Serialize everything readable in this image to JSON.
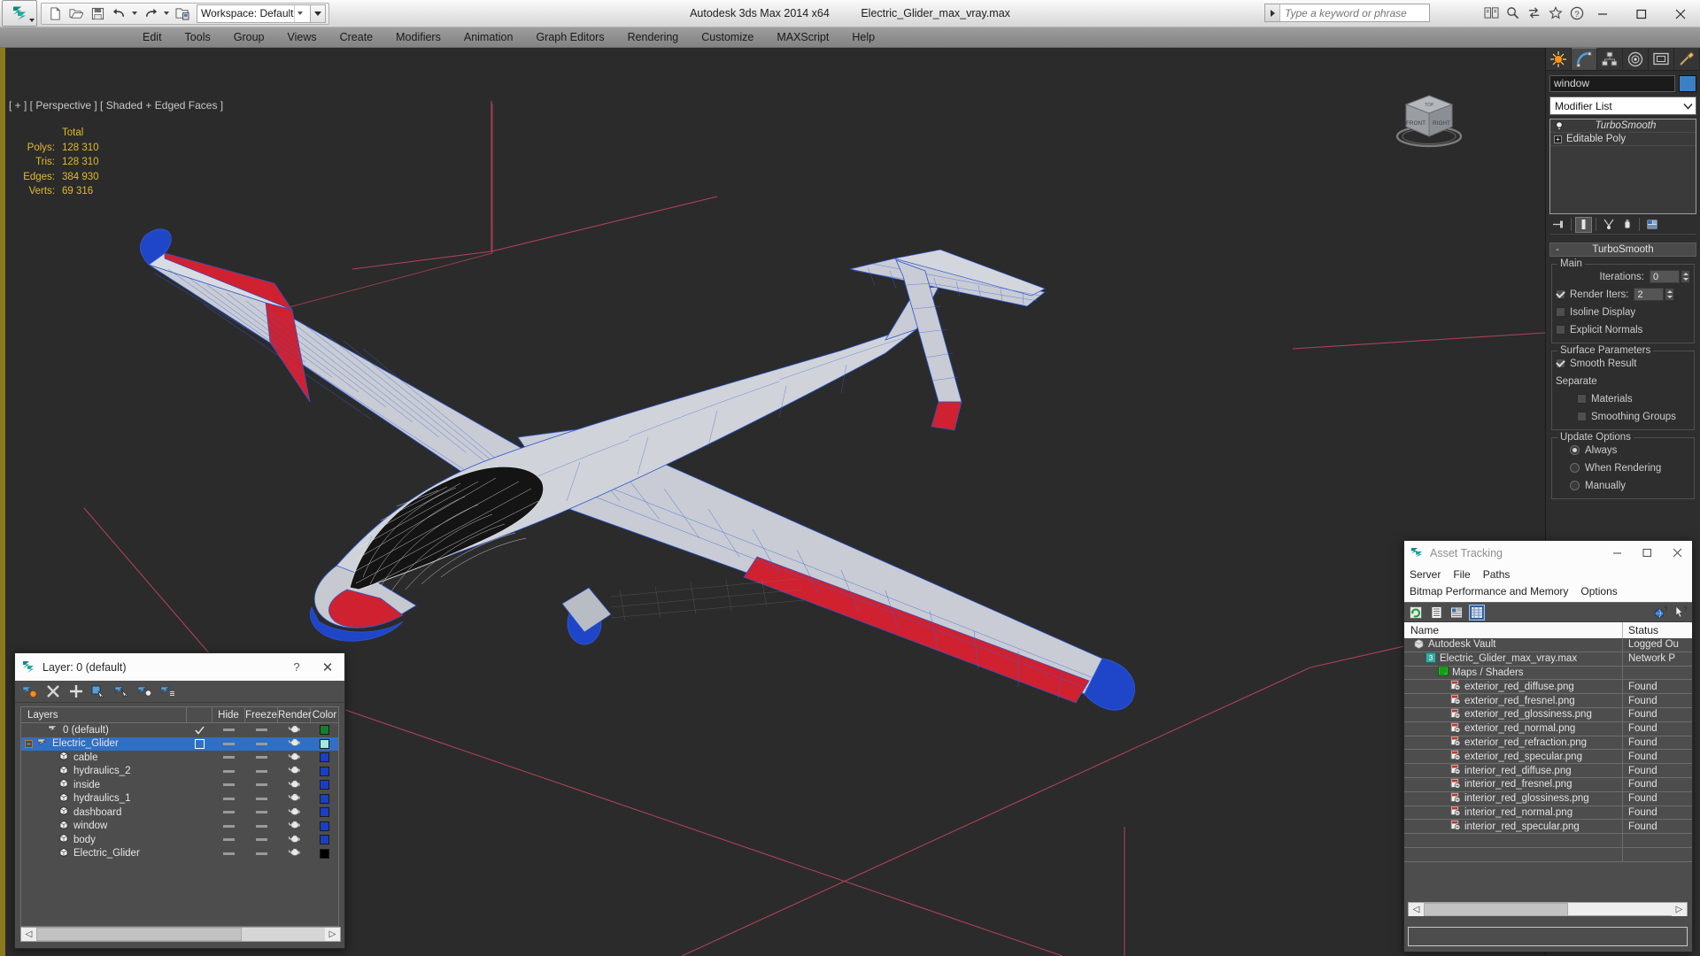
{
  "app": {
    "title": "Autodesk 3ds Max  2014 x64",
    "file": "Electric_Glider_max_vray.max",
    "workspace_label": "Workspace: Default",
    "search_placeholder": "Type a keyword or phrase"
  },
  "menu": {
    "items": [
      "Edit",
      "Tools",
      "Group",
      "Views",
      "Create",
      "Modifiers",
      "Animation",
      "Graph Editors",
      "Rendering",
      "Customize",
      "MAXScript",
      "Help"
    ]
  },
  "viewport": {
    "label": "[ + ] [ Perspective ] [ Shaded + Edged Faces ]",
    "stats_header": "Total",
    "stats": [
      {
        "label": "Polys:",
        "value": "128 310"
      },
      {
        "label": "Tris:",
        "value": "128 310"
      },
      {
        "label": "Edges:",
        "value": "384 930"
      },
      {
        "label": "Verts:",
        "value": "69 316"
      }
    ],
    "viewcube_faces": [
      "FRONT",
      "RIGHT",
      "TOP"
    ],
    "accent_color": "#8a7a1e"
  },
  "command_panel": {
    "tabs": [
      "create-tab",
      "modify-tab",
      "hierarchy-tab",
      "motion-tab",
      "display-tab",
      "utilities-tab"
    ],
    "active_tab": "modify-tab",
    "object_name": "window",
    "object_color": "#3d7fc4",
    "modifier_list_label": "Modifier List",
    "stack": [
      {
        "name": "TurboSmooth",
        "italic": true
      },
      {
        "name": "Editable Poly",
        "italic": false
      }
    ],
    "rollout": {
      "title": "TurboSmooth",
      "groups": [
        {
          "title": "Main",
          "iterations_label": "Iterations:",
          "iterations_value": "0",
          "render_iters_label": "Render Iters:",
          "render_iters_value": "2",
          "render_iters_checked": true,
          "isoline_label": "Isoline Display",
          "isoline_checked": false,
          "explicit_label": "Explicit Normals",
          "explicit_checked": false
        },
        {
          "title": "Surface Parameters",
          "smooth_label": "Smooth Result",
          "smooth_checked": true,
          "separate_label": "Separate",
          "materials_label": "Materials",
          "materials_checked": false,
          "smoothing_groups_label": "Smoothing Groups",
          "smoothing_groups_checked": false
        },
        {
          "title": "Update Options",
          "options": [
            "Always",
            "When Rendering",
            "Manually"
          ],
          "selected": "Always"
        }
      ]
    }
  },
  "layer_dialog": {
    "title": "Layer: 0 (default)",
    "help_label": "?",
    "close_label": "✕",
    "columns": [
      "Layers",
      "Hide",
      "Freeze",
      "Render",
      "Color"
    ],
    "rows": [
      {
        "name": "0 (default)",
        "indent": 1,
        "icon": "layer-icon",
        "current": true,
        "color": "#128028",
        "selected": false,
        "expander": false
      },
      {
        "name": "Electric_Glider",
        "indent": 0,
        "icon": "layer-icon",
        "current": false,
        "color": "#9eecd6",
        "selected": true,
        "expander": true
      },
      {
        "name": "cable",
        "indent": 2,
        "icon": "object-icon",
        "current": false,
        "color": "#1a3fc4",
        "selected": false,
        "expander": false
      },
      {
        "name": "hydraulics_2",
        "indent": 2,
        "icon": "object-icon",
        "current": false,
        "color": "#1a3fc4",
        "selected": false,
        "expander": false
      },
      {
        "name": "inside",
        "indent": 2,
        "icon": "object-icon",
        "current": false,
        "color": "#1a3fc4",
        "selected": false,
        "expander": false
      },
      {
        "name": "hydraulics_1",
        "indent": 2,
        "icon": "object-icon",
        "current": false,
        "color": "#1a3fc4",
        "selected": false,
        "expander": false
      },
      {
        "name": "dashboard",
        "indent": 2,
        "icon": "object-icon",
        "current": false,
        "color": "#1a3fc4",
        "selected": false,
        "expander": false
      },
      {
        "name": "window",
        "indent": 2,
        "icon": "object-icon",
        "current": false,
        "color": "#1a3fc4",
        "selected": false,
        "expander": false
      },
      {
        "name": "body",
        "indent": 2,
        "icon": "object-icon",
        "current": false,
        "color": "#1a3fc4",
        "selected": false,
        "expander": false
      },
      {
        "name": "Electric_Glider",
        "indent": 2,
        "icon": "object-icon",
        "current": false,
        "color": "#000000",
        "selected": false,
        "expander": false
      }
    ]
  },
  "asset_tracking": {
    "title": "Asset Tracking",
    "menus_row1": [
      "Server",
      "File",
      "Paths"
    ],
    "menus_row2": [
      "Bitmap Performance and Memory",
      "Options"
    ],
    "columns": [
      "Name",
      "Status"
    ],
    "rows": [
      {
        "name": "Autodesk Vault",
        "status": "Logged Ou",
        "indent": 0,
        "icon": "vault-icon"
      },
      {
        "name": "Electric_Glider_max_vray.max",
        "status": "Network P",
        "indent": 1,
        "icon": "max-file-icon"
      },
      {
        "name": "Maps / Shaders",
        "status": "",
        "indent": 2,
        "icon": "maps-icon"
      },
      {
        "name": "exterior_red_diffuse.png",
        "status": "Found",
        "indent": 3,
        "icon": "bitmap-icon"
      },
      {
        "name": "exterior_red_fresnel.png",
        "status": "Found",
        "indent": 3,
        "icon": "bitmap-icon"
      },
      {
        "name": "exterior_red_glossiness.png",
        "status": "Found",
        "indent": 3,
        "icon": "bitmap-icon"
      },
      {
        "name": "exterior_red_normal.png",
        "status": "Found",
        "indent": 3,
        "icon": "bitmap-icon"
      },
      {
        "name": "exterior_red_refraction.png",
        "status": "Found",
        "indent": 3,
        "icon": "bitmap-icon"
      },
      {
        "name": "exterior_red_specular.png",
        "status": "Found",
        "indent": 3,
        "icon": "bitmap-icon"
      },
      {
        "name": "interior_red_diffuse.png",
        "status": "Found",
        "indent": 3,
        "icon": "bitmap-icon"
      },
      {
        "name": "interior_red_fresnel.png",
        "status": "Found",
        "indent": 3,
        "icon": "bitmap-icon"
      },
      {
        "name": "interior_red_glossiness.png",
        "status": "Found",
        "indent": 3,
        "icon": "bitmap-icon"
      },
      {
        "name": "interior_red_normal.png",
        "status": "Found",
        "indent": 3,
        "icon": "bitmap-icon"
      },
      {
        "name": "interior_red_specular.png",
        "status": "Found",
        "indent": 3,
        "icon": "bitmap-icon"
      },
      {
        "name": "",
        "status": "",
        "indent": 0,
        "icon": ""
      },
      {
        "name": "",
        "status": "",
        "indent": 0,
        "icon": ""
      }
    ],
    "minimize_label": "—",
    "maximize_label": "□",
    "close_label": "✕"
  },
  "window_controls": {
    "minimize": "—",
    "maximize": "❐",
    "close": "✕"
  }
}
